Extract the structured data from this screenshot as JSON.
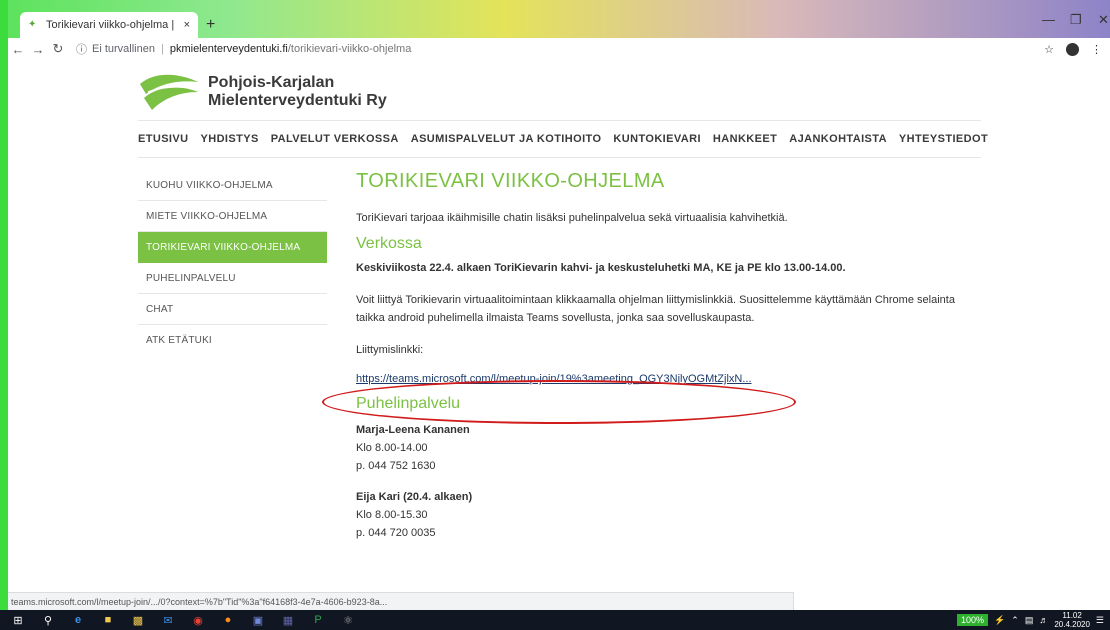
{
  "browser": {
    "tab_title": "Torikievari viikko-ohjelma | Pohjo",
    "tab_close": "×",
    "new_tab": "+",
    "address_security": "Ei turvallinen",
    "address_host": "pkmielenterveydentuki.fi",
    "address_path": "/torikievari-viikko-ohjelma",
    "status_url": "teams.microsoft.com/l/meetup-join/.../0?context=%7b\"Tid\"%3a\"f64168f3-4e7a-4606-b923-8a..."
  },
  "site": {
    "logo_line1": "Pohjois-Karjalan",
    "logo_line2": "Mielenterveydentuki Ry",
    "nav": [
      "ETUSIVU",
      "YHDISTYS",
      "PALVELUT VERKOSSA",
      "ASUMISPALVELUT JA KOTIHOITO",
      "KUNTOKIEVARI",
      "HANKKEET",
      "AJANKOHTAISTA",
      "YHTEYSTIEDOT"
    ],
    "sidebar": [
      {
        "label": "KUOHU VIIKKO-OHJELMA",
        "active": false
      },
      {
        "label": "MIETE VIIKKO-OHJELMA",
        "active": false
      },
      {
        "label": "TORIKIEVARI VIIKKO-OHJELMA",
        "active": true
      },
      {
        "label": "PUHELINPALVELU",
        "active": false
      },
      {
        "label": "CHAT",
        "active": false
      },
      {
        "label": "ATK ETÄTUKI",
        "active": false
      }
    ]
  },
  "content": {
    "title": "TORIKIEVARI VIIKKO-OHJELMA",
    "intro": "ToriKievari tarjoaa ikäihmisille chatin lisäksi puhelinpalvelua sekä virtuaalisia kahvihetkiä.",
    "h_online": "Verkossa",
    "schedule": "Keskiviikosta 22.4. alkaen ToriKievarin kahvi- ja keskusteluhetki MA, KE ja PE klo 13.00-14.00.",
    "join_text": "Voit liittyä Torikievarin virtuaalitoimintaan klikkaamalla ohjelman liittymislinkkiä. Suosittelemme käyttämään Chrome selainta taikka android puhelimella ilmaista Teams sovellusta, jonka saa sovelluskaupasta.",
    "link_label": "Liittymislinkki:",
    "link_text": "https://teams.microsoft.com/l/meetup-join/19%3ameeting_OGY3NjlyOGMtZjlxN...",
    "h_phone": "Puhelinpalvelu",
    "contact1_name": "Marja-Leena Kananen",
    "contact1_hours": "Klo 8.00-14.00",
    "contact1_phone": "p. 044 752 1630",
    "contact2_name": "Eija Kari (20.4. alkaen)",
    "contact2_hours": "Klo 8.00-15.30",
    "contact2_phone": "p. 044 720 0035"
  },
  "taskbar": {
    "battery": "100%",
    "time": "11.02",
    "date": "20.4.2020"
  },
  "colors": {
    "accent_green": "#7bc143",
    "link_blue": "#1b3a6a",
    "annotation_red": "#d11a1a"
  }
}
